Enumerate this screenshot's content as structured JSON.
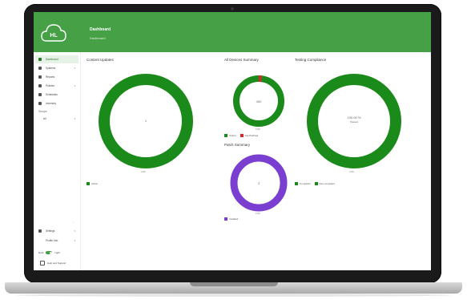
{
  "app": {
    "logo_text": "HL",
    "header_title": "Dashboard",
    "header_subtitle": "Dashboard"
  },
  "sidebar": {
    "items": [
      {
        "label": "Dashboard",
        "icon": "dashboard-icon",
        "active": true
      },
      {
        "label": "Systems",
        "icon": "systems-icon"
      },
      {
        "label": "Reports",
        "icon": "reports-icon"
      },
      {
        "label": "Policies",
        "icon": "policies-icon"
      },
      {
        "label": "Schedules",
        "icon": "schedules-icon"
      },
      {
        "label": "Inventory",
        "icon": "inventory-icon"
      }
    ],
    "section_label": "Groups",
    "group_item": "All",
    "bottom_items": [
      {
        "label": "Settings",
        "icon": "settings-icon"
      },
      {
        "label": "Profile Info",
        "icon": "profile-icon"
      }
    ],
    "theme_dark": "Dark",
    "theme_light": "Light",
    "help_label": "Help and Support"
  },
  "panels": {
    "content_updates": {
      "title": "Content Updates",
      "center": "1",
      "tick": "1000",
      "legend": [
        "Active"
      ]
    },
    "all_devices_summary": {
      "title": "All Devices Summary",
      "center": "400",
      "tick": "1000",
      "legend": [
        "Online",
        "Not Patched"
      ]
    },
    "patch_summary": {
      "title": "Patch Summary",
      "center": "3",
      "tick": "1000",
      "legend": [
        "Installed"
      ]
    },
    "testing_compliance": {
      "title": "Testing Compliance",
      "center": "100.00 %",
      "center_sub": "Passed",
      "tick": "1000",
      "legend": [
        "Compliant",
        "Non-compliant"
      ]
    }
  },
  "colors": {
    "header": "#45a046",
    "ring_green": "#1a8a1a",
    "ring_red": "#d42a2a",
    "ring_purple": "#7a3fd0"
  }
}
